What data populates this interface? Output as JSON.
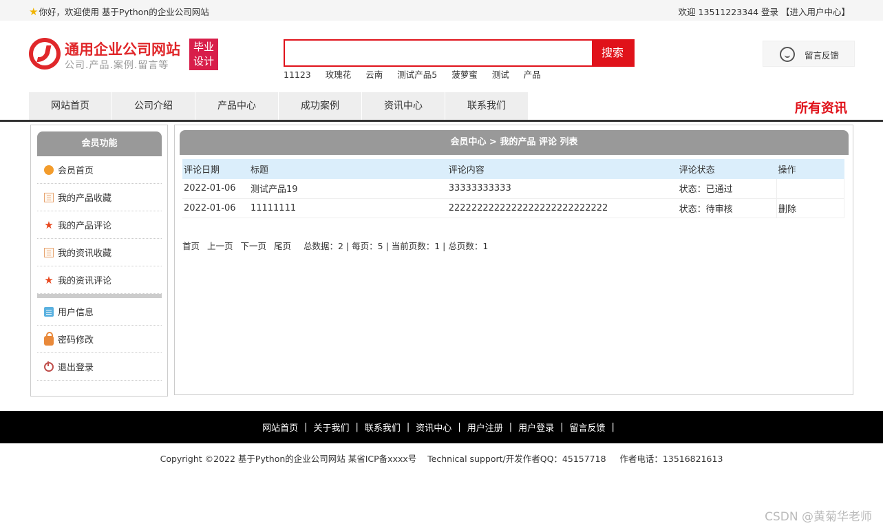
{
  "topbar": {
    "welcome": "你好，欢迎使用 基于Python的企业公司网站",
    "greeting": "欢迎 13511223344 登录",
    "user_center": "【进入用户中心】"
  },
  "header": {
    "site_name": "通用企业公司网站",
    "slogan": "公司.产品.案例.留言等",
    "badge_line1": "毕业",
    "badge_line2": "设计",
    "search_value": "",
    "search_button": "搜索",
    "hotwords": [
      "11123",
      "玫瑰花",
      "云南",
      "测试产品5",
      "菠萝蜜",
      "测试",
      "产品"
    ],
    "feedback_label": "留言反馈"
  },
  "nav": {
    "items": [
      "网站首页",
      "公司介绍",
      "产品中心",
      "成功案例",
      "资讯中心",
      "联系我们"
    ],
    "all_news": "所有资讯"
  },
  "sidebar": {
    "title": "会员功能",
    "items": [
      "会员首页",
      "我的产品收藏",
      "我的产品评论",
      "我的资讯收藏",
      "我的资讯评论"
    ],
    "items2": [
      "用户信息",
      "密码修改",
      "退出登录"
    ]
  },
  "main": {
    "title": "会员中心 > 我的产品 评论 列表",
    "columns": [
      "评论日期",
      "标题",
      "评论内容",
      "评论状态",
      "操作"
    ],
    "rows": [
      {
        "date": "2022-01-06",
        "title": "测试产品19",
        "content": "33333333333",
        "status": "状态：已通过",
        "op": ""
      },
      {
        "date": "2022-01-06",
        "title": "11111111",
        "content": "2222222222222222222222222222",
        "status": "状态：待审核",
        "op": "删除"
      }
    ],
    "pager": {
      "first": "首页",
      "prev": "上一页",
      "next": "下一页",
      "last": "尾页",
      "info": "总数据：2 | 每页：5 | 当前页数：1 | 总页数：1"
    }
  },
  "footer": {
    "links": [
      "网站首页",
      "关于我们",
      "联系我们",
      "资讯中心",
      "用户注册",
      "用户登录",
      "留言反馈"
    ],
    "separator": "|",
    "copyright": "Copyright ©2022 基于Python的企业公司网站 某省ICP备xxxx号    Technical support/开发作者QQ：45157718     作者电话：13516821613"
  },
  "watermark": "CSDN @黄菊华老师"
}
